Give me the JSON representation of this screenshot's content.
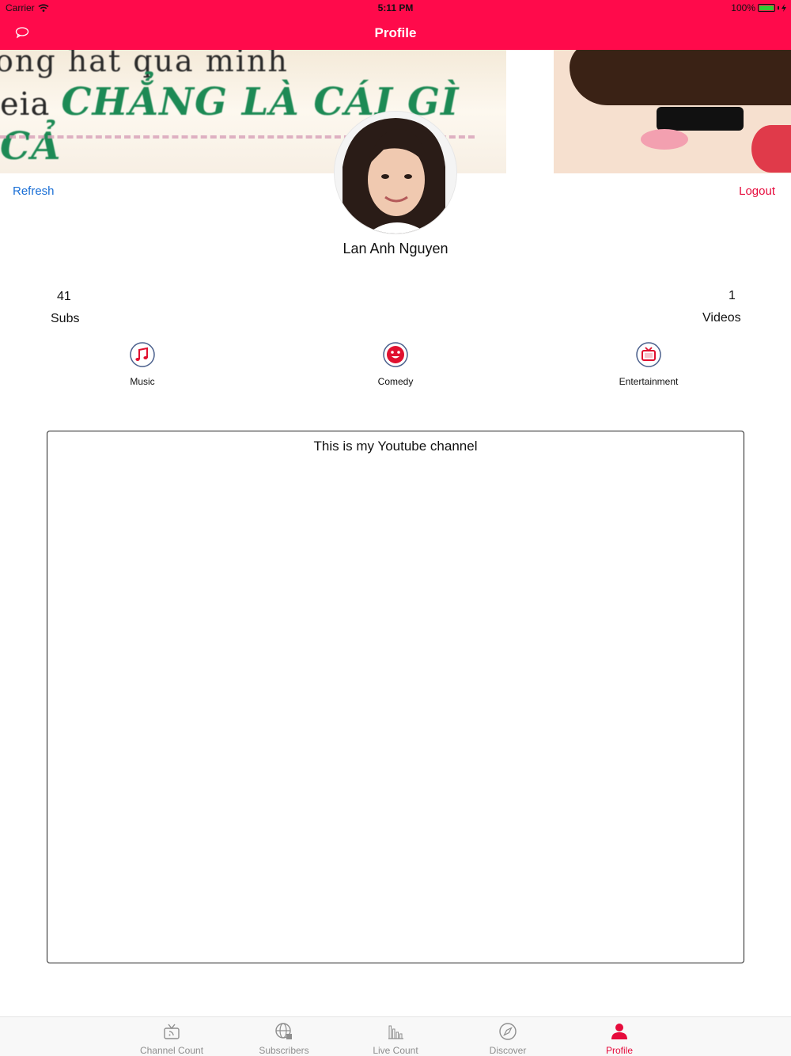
{
  "status_bar": {
    "carrier": "Carrier",
    "time": "5:11 PM",
    "battery": "100%"
  },
  "nav": {
    "title": "Profile",
    "left_icon": "chat-bubble-icon"
  },
  "banner": {
    "line1": "ong hat qua minh",
    "line2_prefix": "eia",
    "line2": "CHẲNG LÀ CÁI GÌ CẢ"
  },
  "actions": {
    "refresh": "Refresh",
    "logout": "Logout"
  },
  "profile": {
    "name": "Lan Anh Nguyen"
  },
  "stats": {
    "subs": {
      "value": "41",
      "label": "Subs"
    },
    "videos": {
      "value": "1",
      "label": "Videos"
    }
  },
  "categories": [
    {
      "label": "Music",
      "icon": "music-note-icon"
    },
    {
      "label": "Comedy",
      "icon": "smiley-face-icon"
    },
    {
      "label": "Entertainment",
      "icon": "tv-icon"
    }
  ],
  "description": "This is my Youtube channel",
  "tabs": [
    {
      "label": "Channel Count",
      "icon": "tv-rss-icon"
    },
    {
      "label": "Subscribers",
      "icon": "globe-icon"
    },
    {
      "label": "Live Count",
      "icon": "bar-chart-icon"
    },
    {
      "label": "Discover",
      "icon": "compass-icon"
    },
    {
      "label": "Profile",
      "icon": "person-icon",
      "active": true
    }
  ],
  "colors": {
    "accent": "#ff0a4b",
    "link_blue": "#1a6fd6",
    "logout_red": "#e60b3c",
    "tab_inactive": "#8e8e8e"
  }
}
